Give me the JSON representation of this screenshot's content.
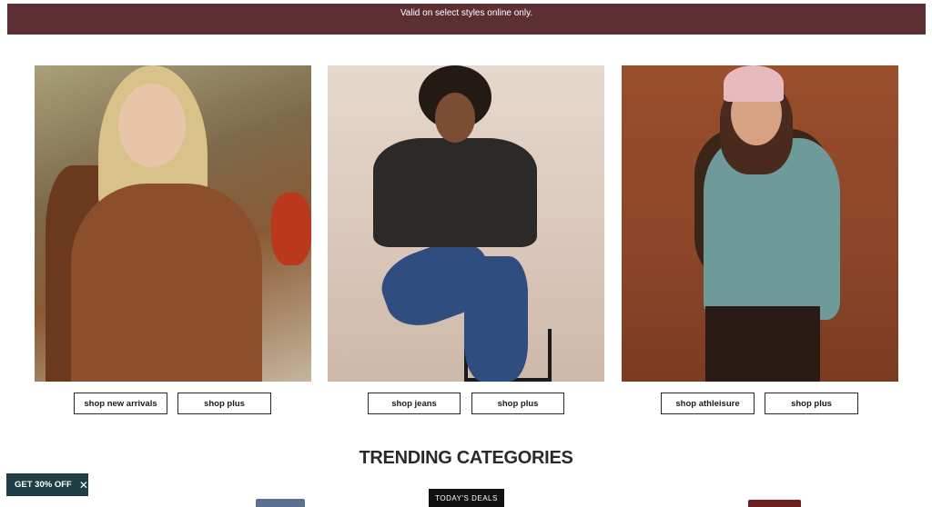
{
  "banner": {
    "text": "Valid on select styles online only."
  },
  "cards": [
    {
      "buttons": [
        "shop new arrivals",
        "shop plus"
      ]
    },
    {
      "buttons": [
        "shop jeans",
        "shop plus"
      ]
    },
    {
      "buttons": [
        "shop athleisure",
        "shop plus"
      ]
    }
  ],
  "section": {
    "title": "TRENDING CATEGORIES"
  },
  "discount": {
    "label": "GET 30% OFF",
    "close_icon": "close-icon"
  },
  "deals_tab": {
    "label": "TODAY'S DEALS"
  },
  "colors": {
    "banner_bg": "#5c2f35",
    "discount_bg": "#1f3d45",
    "deals_bg": "#111111"
  }
}
